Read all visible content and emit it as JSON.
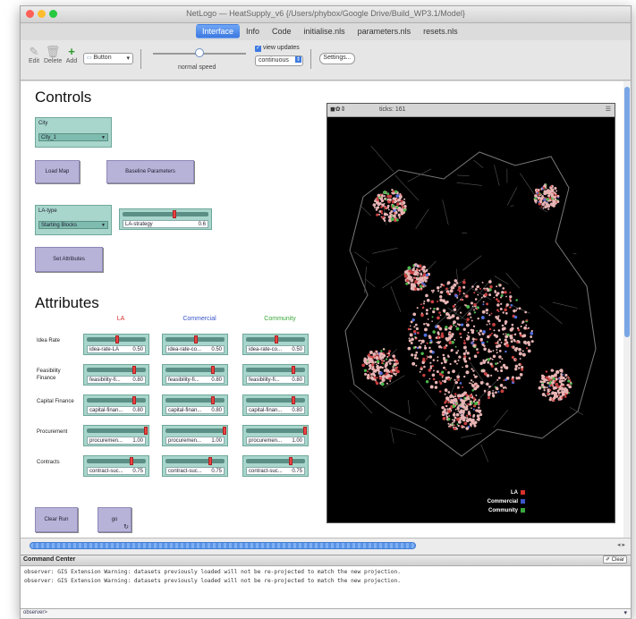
{
  "window": {
    "title": "NetLogo — HeatSupply_v6 {/Users/phybox/Google Drive/Build_WP3.1/Model}",
    "tabs": [
      "Interface",
      "Info",
      "Code",
      "initialise.nls",
      "parameters.nls",
      "resets.nls"
    ],
    "active_tab": "Interface"
  },
  "toolbar": {
    "edit": "Edit",
    "delete": "Delete",
    "add": "Add",
    "widget_type": "Button",
    "speed_label": "normal speed",
    "speed_level": 0.5,
    "view_updates_label": "view updates",
    "view_updates_checked": true,
    "update_mode": "continuous",
    "settings": "Settings..."
  },
  "controls": {
    "heading": "Controls",
    "city_label": "City",
    "city_value": "City_1",
    "load_map": "Load Map",
    "baseline_params": "Baseline Parameters",
    "la_type_label": "LA-type",
    "la_type_value": "Starting Blocks",
    "la_strategy_label": "LA-strategy",
    "la_strategy_value": "0.6",
    "la_strategy_level": 0.6,
    "set_attributes": "Set Attributes"
  },
  "attributes": {
    "heading": "Attributes",
    "columns": [
      {
        "name": "LA",
        "color": "#d8302c"
      },
      {
        "name": "Commercial",
        "color": "#3a56c8"
      },
      {
        "name": "Community",
        "color": "#3aa83a"
      }
    ],
    "rows": [
      {
        "label": "Idea Rate",
        "sliders": [
          {
            "name": "idea-rate-LA",
            "value": "0.50",
            "level": 0.5
          },
          {
            "name": "idea-rate-co...",
            "value": "0.50",
            "level": 0.5
          },
          {
            "name": "idea-rate-co...",
            "value": "0.50",
            "level": 0.5
          }
        ]
      },
      {
        "label": "Feasibility Finance",
        "sliders": [
          {
            "name": "feasibility-fi...",
            "value": "0.80",
            "level": 0.8
          },
          {
            "name": "feasibility-fi...",
            "value": "0.80",
            "level": 0.8
          },
          {
            "name": "feasibility-fi...",
            "value": "0.80",
            "level": 0.8
          }
        ]
      },
      {
        "label": "Capital Finance",
        "sliders": [
          {
            "name": "capital-finan...",
            "value": "0.80",
            "level": 0.8
          },
          {
            "name": "capital-finan...",
            "value": "0.80",
            "level": 0.8
          },
          {
            "name": "capital-finan...",
            "value": "0.80",
            "level": 0.8
          }
        ]
      },
      {
        "label": "Procurement",
        "sliders": [
          {
            "name": "procuremen...",
            "value": "1.00",
            "level": 1.0
          },
          {
            "name": "procuremen...",
            "value": "1.00",
            "level": 1.0
          },
          {
            "name": "procuremen...",
            "value": "1.00",
            "level": 1.0
          }
        ]
      },
      {
        "label": "Contracts",
        "sliders": [
          {
            "name": "contract-suc...",
            "value": "0.75",
            "level": 0.75
          },
          {
            "name": "contract-suc...",
            "value": "0.75",
            "level": 0.75
          },
          {
            "name": "contract-suc...",
            "value": "0.75",
            "level": 0.75
          }
        ]
      }
    ],
    "clear_run": "Clear Run",
    "go": "go"
  },
  "view": {
    "ticks_label": "ticks: 161",
    "legend": [
      {
        "name": "LA",
        "color": "#d8302c"
      },
      {
        "name": "Commercial",
        "color": "#3a56c8"
      },
      {
        "name": "Community",
        "color": "#3aa83a"
      }
    ]
  },
  "command_center": {
    "title": "Command Center",
    "clear": "Clear",
    "output": [
      "observer: GIS Extension Warning: datasets previously loaded will not be re-projected to match the new projection.",
      "observer: GIS Extension Warning: datasets previously loaded will not be re-projected to match the new projection."
    ],
    "prompt": "observer>"
  }
}
